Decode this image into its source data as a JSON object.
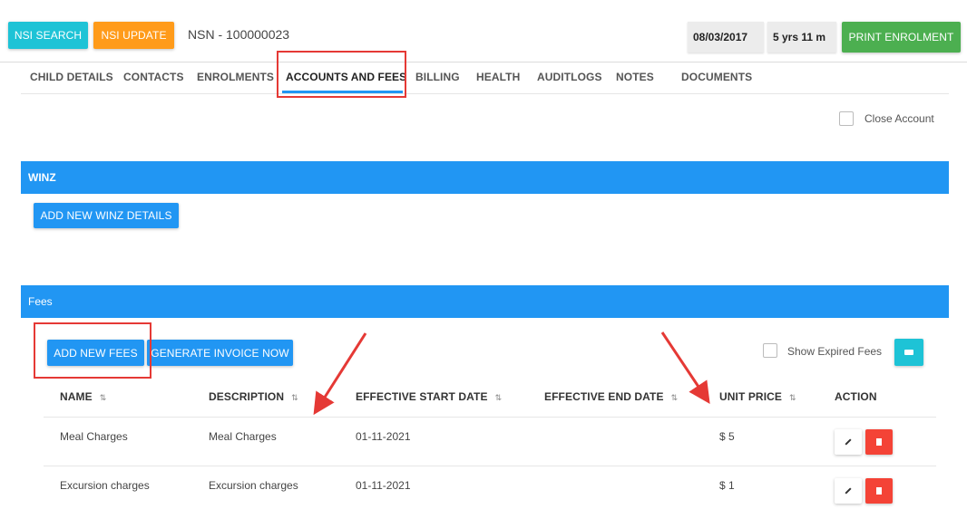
{
  "header": {
    "nsi_search_label": "NSI SEARCH",
    "nsi_update_label": "NSI UPDATE",
    "nsn_text": "NSN - 100000023",
    "date_value": "08/03/2017",
    "age_value": "5 yrs 11 m",
    "print_enrolment_label": "PRINT ENROLMENT"
  },
  "tabs": [
    {
      "label": "CHILD DETAILS"
    },
    {
      "label": "CONTACTS"
    },
    {
      "label": "ENROLMENTS"
    },
    {
      "label": "ACCOUNTS AND FEES"
    },
    {
      "label": "BILLING"
    },
    {
      "label": "HEALTH"
    },
    {
      "label": "AUDITLOGS"
    },
    {
      "label": "NOTES"
    },
    {
      "label": "DOCUMENTS"
    }
  ],
  "close_account_label": "Close Account",
  "winz": {
    "title": "WINZ",
    "add_button_label": "ADD NEW WINZ DETAILS"
  },
  "fees": {
    "title": "Fees",
    "add_button_label": "ADD NEW FEES",
    "generate_invoice_label": "GENERATE INVOICE NOW",
    "show_expired_label": "Show Expired Fees",
    "columns": [
      "NAME",
      "DESCRIPTION",
      "EFFECTIVE START DATE",
      "EFFECTIVE END DATE",
      "UNIT PRICE",
      "ACTION"
    ],
    "sort_glyph": "⇅",
    "rows": [
      {
        "name": "Meal Charges",
        "description": "Meal Charges",
        "start_date": "01-11-2021",
        "end_date": "",
        "unit_price": "$ 5"
      },
      {
        "name": "Excursion charges",
        "description": "Excursion charges",
        "start_date": "01-11-2021",
        "end_date": "",
        "unit_price": "$ 1"
      }
    ]
  },
  "colors": {
    "cyan": "#1ec3d6",
    "orange": "#ff9b1a",
    "green": "#4caf50",
    "blue": "#2196f3",
    "red": "#f44336",
    "annotation_red": "#e53935"
  }
}
